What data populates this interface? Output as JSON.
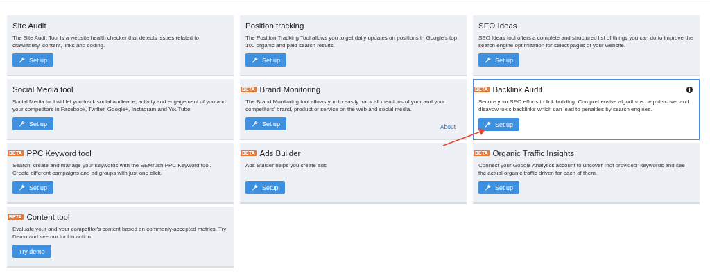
{
  "cards": [
    {
      "title": "Site Audit",
      "info": false,
      "selected": false,
      "description": "The Site Audit Tool is a website health checker that detects issues related to crawlability, content, links and coding.",
      "button": {
        "label": "Set up",
        "icon": true
      }
    },
    {
      "title": "Position tracking",
      "info": false,
      "selected": false,
      "description": "The Position Tracking Tool allows you to get daily updates on positions in Google's top 100 organic and paid search results.",
      "button": {
        "label": "Set up",
        "icon": true
      }
    },
    {
      "title": "SEO Ideas",
      "info": false,
      "selected": false,
      "description": "SEO Ideas tool offers a complete and structured list of things you can do to improve the search engine optimization for select pages of your website.",
      "button": {
        "label": "Set up",
        "icon": true
      }
    },
    {
      "title": "Social Media tool",
      "info": false,
      "selected": false,
      "description": "Social Media tool will let you track social audience, activity and engagement of you and your competitors in Facebook, Twitter, Google+, Instagram and YouTube.",
      "button": {
        "label": "Set up",
        "icon": true
      }
    },
    {
      "title": "Brand Monitoring",
      "badge": "BETA",
      "info": false,
      "selected": false,
      "description": "The Brand Monitoring tool allows you to easily track all mentions of your and your competitors' brand, product or service on the web and social media.",
      "button": {
        "label": "Set up",
        "icon": true
      },
      "link": "About"
    },
    {
      "title": "Backlink Audit",
      "badge": "BETA",
      "info": true,
      "selected": true,
      "description": "Secure your SEO efforts in link building. Comprehensive algorithms help discover and disavow toxic backlinks which can lead to penalties by search engines.",
      "button": {
        "label": "Set up",
        "icon": true
      }
    },
    {
      "title": "PPC Keyword tool",
      "badge": "BETA",
      "info": false,
      "selected": false,
      "description": "Search, create and manage your keywords with the SEMrush PPC Keyword tool. Create different campaigns and ad groups with just one click.",
      "button": {
        "label": "Set up",
        "icon": true
      }
    },
    {
      "title": "Ads Builder",
      "badge": "BETA",
      "info": false,
      "selected": false,
      "description": "Ads Builder helps you create ads",
      "button": {
        "label": "Setup",
        "icon": true
      }
    },
    {
      "title": "Organic Traffic Insights",
      "badge": "BETA",
      "info": false,
      "selected": false,
      "description": "Connect your Google Analytics account to uncover \"not provided\" keywords and see the actual organic traffic driven for each of them.",
      "button": {
        "label": "Set up",
        "icon": true
      }
    },
    {
      "title": "Content tool",
      "badge": "BETA",
      "info": false,
      "selected": false,
      "description": "Evaluate your and your competitor's content based on commonly-accepted metrics. Try Demo and see our tool in action.",
      "button": {
        "label": "Try demo",
        "icon": false
      }
    }
  ]
}
